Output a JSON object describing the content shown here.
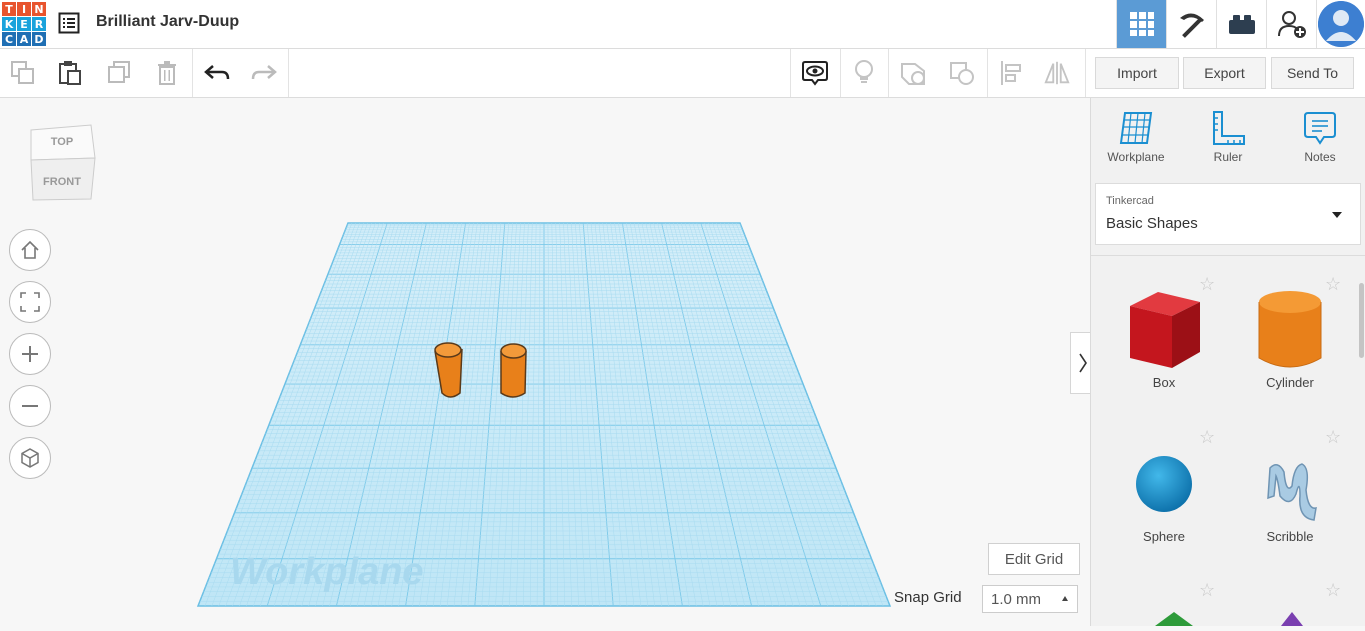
{
  "app": {
    "logo_letters": [
      "T",
      "I",
      "N",
      "K",
      "E",
      "R",
      "C",
      "A",
      "D"
    ],
    "logo_colors": [
      "#e8542e",
      "#e8542e",
      "#e8542e",
      "#1aa3dc",
      "#1aa3dc",
      "#1aa3dc",
      "#1f6fb4",
      "#1f6fb4",
      "#1f6fb4"
    ],
    "project_title": "Brilliant Jarv-Duup"
  },
  "topbar": {
    "views": [
      "grid-view-icon",
      "pickaxe-icon",
      "bricks-icon",
      "add-user-icon"
    ],
    "accent": "#5b9bd5"
  },
  "toolbar": {
    "import_label": "Import",
    "export_label": "Export",
    "send_to_label": "Send To"
  },
  "viewcube": {
    "top": "TOP",
    "front": "FRONT"
  },
  "workplane": {
    "label": "Workplane",
    "grid_color": "#7cc9e9",
    "edit_grid_label": "Edit Grid",
    "snap_grid_label": "Snap Grid",
    "snap_value": "1.0 mm"
  },
  "objects": [
    {
      "type": "cylinder",
      "color": "#e8801a"
    },
    {
      "type": "cylinder",
      "color": "#e8801a"
    }
  ],
  "panel": {
    "tools": [
      {
        "label": "Workplane",
        "icon": "workplane-icon"
      },
      {
        "label": "Ruler",
        "icon": "ruler-icon"
      },
      {
        "label": "Notes",
        "icon": "notes-icon"
      }
    ],
    "library_source": "Tinkercad",
    "library_name": "Basic Shapes",
    "shapes": [
      {
        "label": "Box",
        "color": "#d9262e"
      },
      {
        "label": "Cylinder",
        "color": "#e8801a"
      },
      {
        "label": "Sphere",
        "color": "#1b9ad6"
      },
      {
        "label": "Scribble",
        "color": "#9ec3de"
      }
    ]
  }
}
